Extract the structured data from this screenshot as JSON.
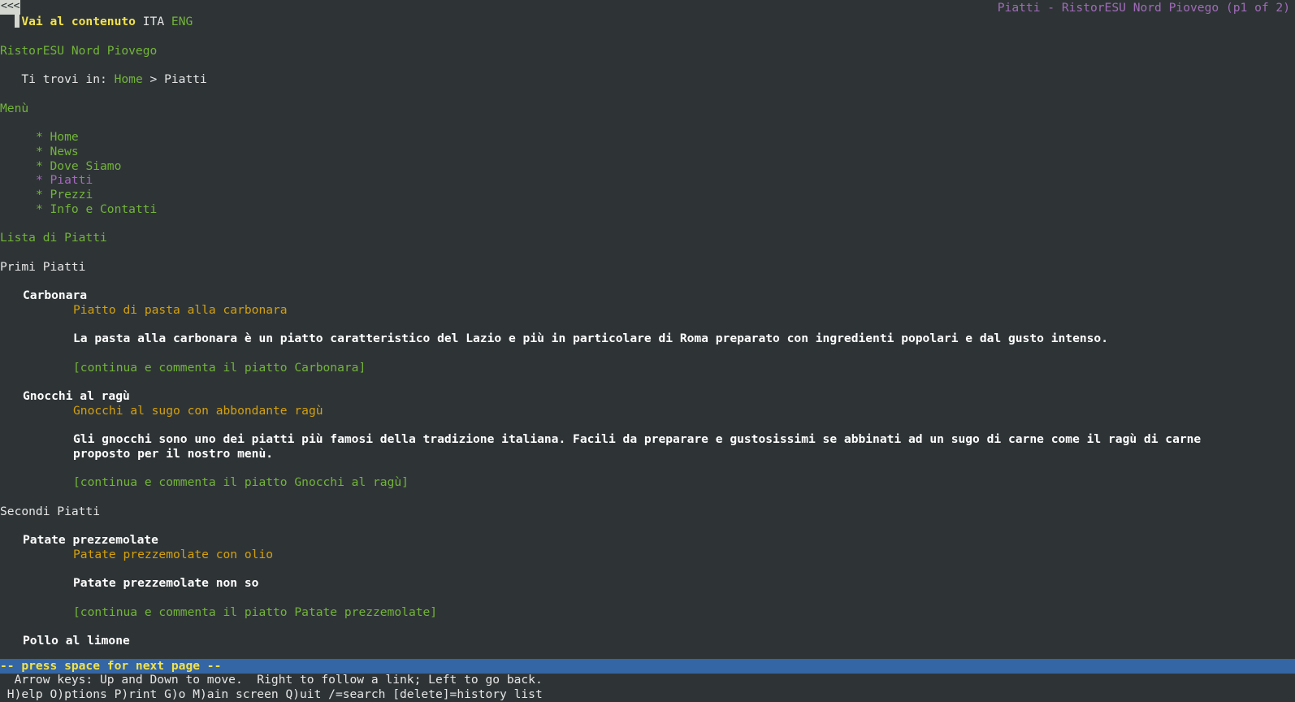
{
  "window": {
    "title": "Piatti - RistorESU Nord Piovego (p1 of 2)",
    "back_marker": "<<<"
  },
  "topnav": {
    "skip_link": "Vai al contenuto",
    "lang_ita": "ITA",
    "lang_eng": "ENG"
  },
  "site": {
    "name": "RistorESU Nord Piovego"
  },
  "breadcrumb": {
    "prefix": "Ti trovi in: ",
    "home": "Home",
    "separator": " > ",
    "current": "Piatti"
  },
  "menu": {
    "heading": "Menù",
    "bullet": "* ",
    "items": [
      {
        "label": "Home"
      },
      {
        "label": "News"
      },
      {
        "label": "Dove Siamo"
      },
      {
        "label": "Piatti"
      },
      {
        "label": "Prezzi"
      },
      {
        "label": "Info e Contatti"
      }
    ]
  },
  "content": {
    "heading": "Lista di Piatti",
    "section_primi": "Primi Piatti",
    "section_secondi": "Secondi Piatti",
    "dishes": [
      {
        "name": "Carbonara",
        "subtitle": "Piatto di pasta alla carbonara",
        "description_lines": [
          "La pasta alla carbonara è un piatto caratteristico del Lazio e più in particolare di Roma preparato con ingredienti popolari e dal gusto intenso."
        ],
        "link": "[continua e commenta il piatto Carbonara]"
      },
      {
        "name": "Gnocchi al ragù",
        "subtitle": "Gnocchi al sugo con abbondante ragù",
        "description_lines": [
          "Gli gnocchi sono uno dei piatti più famosi della tradizione italiana. Facili da preparare e gustosissimi se abbinati ad un sugo di carne come il ragù di carne",
          "proposto per il nostro menù."
        ],
        "link": "[continua e commenta il piatto Gnocchi al ragù]"
      },
      {
        "name": "Patate prezzemolate",
        "subtitle": "Patate prezzemolate con olio",
        "description_lines": [
          "Patate prezzemolate non so"
        ],
        "link": "[continua e commenta il piatto Patate prezzemolate]"
      },
      {
        "name": "Pollo al limone"
      }
    ]
  },
  "status": {
    "pager": "-- press space for next page --",
    "help_1": "  Arrow keys: Up and Down to move.  Right to follow a link; Left to go back.",
    "help_2": " H)elp O)ptions P)rint G)o M)ain screen Q)uit /=search [delete]=history list"
  },
  "colors": {
    "background": "#2e3436",
    "link": "#73b43a",
    "current_link": "#f2e24d",
    "visited_link": "#a86ac0",
    "subtitle": "#d4a00f",
    "status_bar": "#3465a4"
  }
}
